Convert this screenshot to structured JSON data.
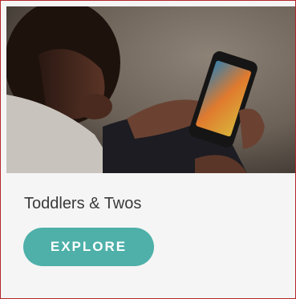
{
  "card": {
    "title": "Toddlers & Twos",
    "button_label": "EXPLORE",
    "image_icon": "photo-child-with-phone",
    "colors": {
      "border": "#b3262b",
      "button": "#4eb0a9",
      "title": "#3a3a3a",
      "background": "#f5f5f5"
    }
  }
}
